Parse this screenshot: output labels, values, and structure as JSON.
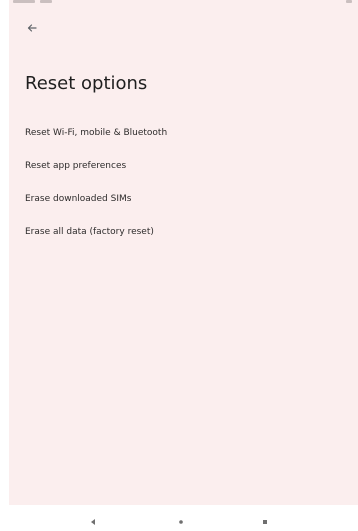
{
  "header": {
    "back_icon": "arrow-left-icon"
  },
  "page": {
    "title": "Reset options"
  },
  "options": [
    {
      "label": "Reset Wi-Fi, mobile & Bluetooth"
    },
    {
      "label": "Reset app preferences"
    },
    {
      "label": "Erase downloaded SIMs"
    },
    {
      "label": "Erase all data (factory reset)"
    }
  ],
  "system_nav": {
    "back_icon": "nav-back-icon",
    "home_icon": "nav-home-icon",
    "recents_icon": "nav-recents-icon"
  },
  "colors": {
    "background": "#fbeeee",
    "text": "#202124"
  }
}
